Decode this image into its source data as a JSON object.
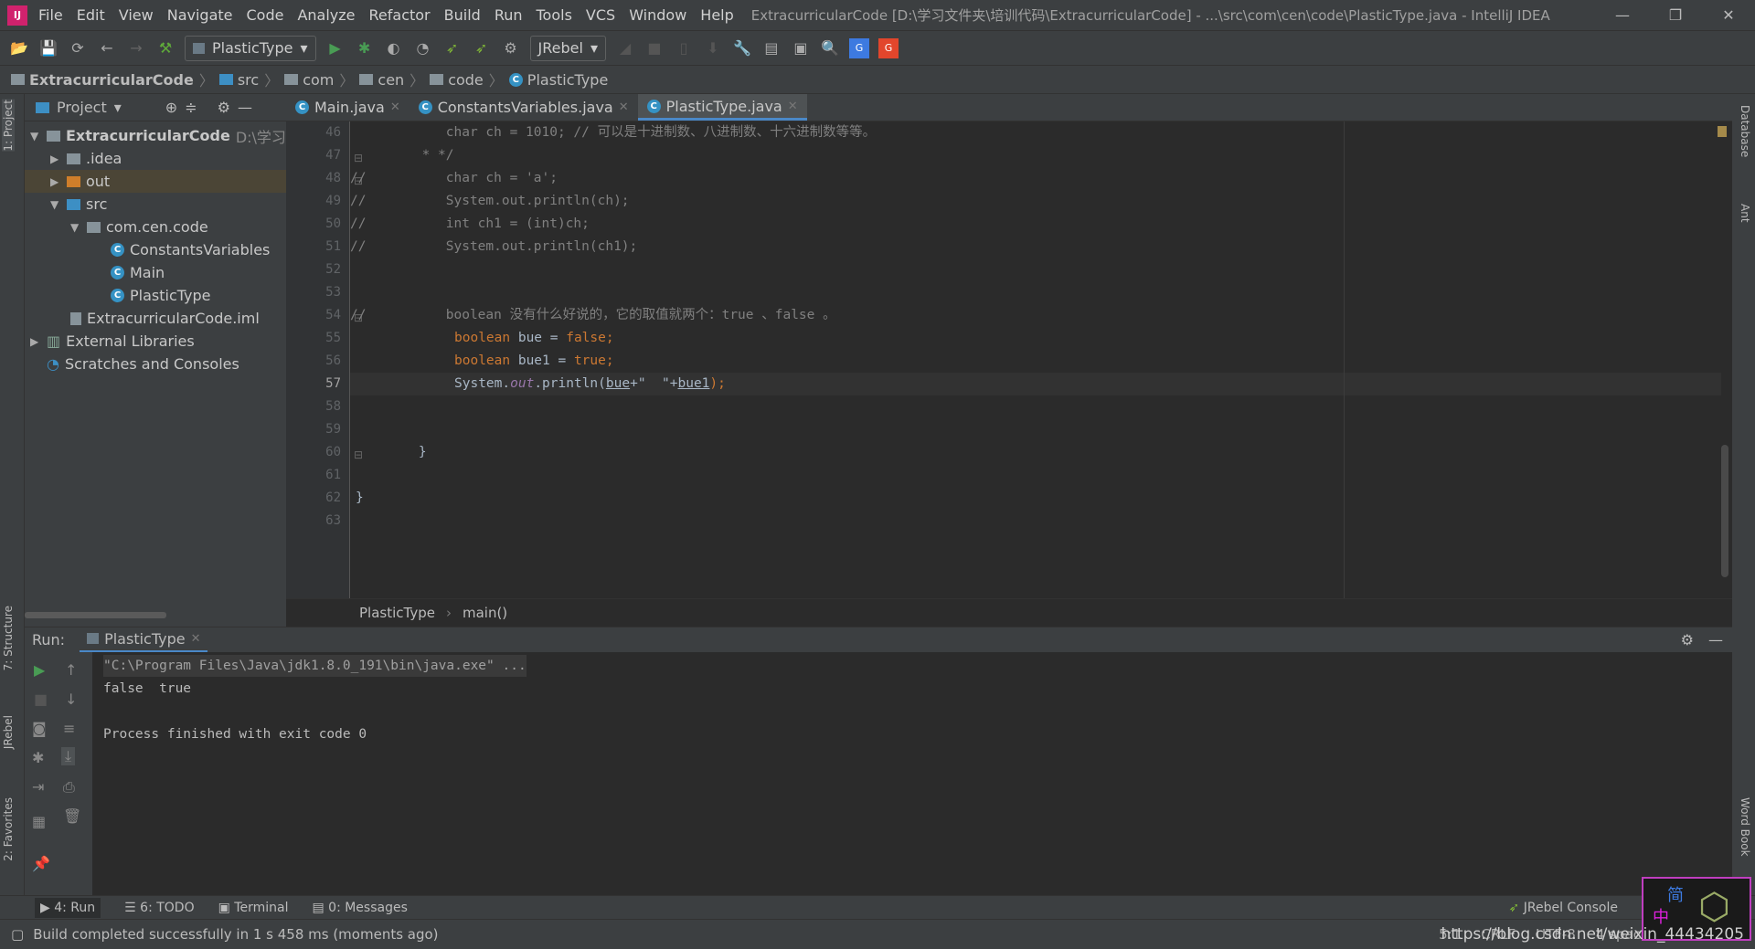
{
  "window": {
    "title": "ExtracurricularCode [D:\\学习文件夹\\培训代码\\ExtracurricularCode] - ...\\src\\com\\cen\\code\\PlasticType.java - IntelliJ IDEA",
    "controls": [
      "—",
      "❐",
      "✕"
    ]
  },
  "menu": [
    "File",
    "Edit",
    "View",
    "Navigate",
    "Code",
    "Analyze",
    "Refactor",
    "Build",
    "Run",
    "Tools",
    "VCS",
    "Window",
    "Help"
  ],
  "toolbar": {
    "run_config": "PlasticType",
    "jrebel": "JRebel"
  },
  "breadcrumb": [
    "ExtracurricularCode",
    "src",
    "com",
    "cen",
    "code",
    "PlasticType"
  ],
  "project": {
    "header": "Project",
    "tree": [
      {
        "label": "ExtracurricularCode",
        "hint": "D:\\学习文件"
      },
      {
        "label": ".idea"
      },
      {
        "label": "out"
      },
      {
        "label": "src"
      },
      {
        "label": "com.cen.code"
      },
      {
        "label": "ConstantsVariables"
      },
      {
        "label": "Main"
      },
      {
        "label": "PlasticType"
      },
      {
        "label": "ExtracurricularCode.iml"
      },
      {
        "label": "External Libraries"
      },
      {
        "label": "Scratches and Consoles"
      }
    ]
  },
  "side_tabs": {
    "left": [
      "1: Project",
      "7: Structure",
      "JRebel",
      "2: Favorites"
    ],
    "right": [
      "Database",
      "Ant",
      "Word Book"
    ]
  },
  "editor": {
    "tabs": [
      "Main.java",
      "ConstantsVariables.java",
      "PlasticType.java"
    ],
    "active_tab": 2,
    "line_numbers": [
      "46",
      "47",
      "48",
      "49",
      "50",
      "51",
      "52",
      "53",
      "54",
      "55",
      "56",
      "57",
      "58",
      "59",
      "60",
      "61",
      "62",
      "63"
    ],
    "current_line": "57",
    "crumbs": [
      "PlasticType",
      "main()"
    ]
  },
  "code": {
    "l46": "            char ch = 1010; // 可以是十进制数、八进制数、十六进制数等等。",
    "l47": "         * */",
    "l48": "//          char ch = 'a';",
    "l49": "//          System.out.println(ch);",
    "l50": "//          int ch1 = (int)ch;",
    "l51": "//          System.out.println(ch1);",
    "l54": "//          boolean 没有什么好说的，它的取值就两个：true 、false 。",
    "l55a": "boolean",
    "l55b": " bue = ",
    "l55c": "false;",
    "l56a": "boolean",
    "l56b": " bue1 = ",
    "l56c": "true;",
    "l57a": "System.",
    "l57b": "out",
    "l57c": ".println(",
    "l57d": "bue",
    "l57e": "+\"  \"+",
    "l57f": "bue1",
    "l57g": ");",
    "l60": "    }",
    "l62": "}"
  },
  "run": {
    "label": "Run:",
    "tab": "PlasticType",
    "output": [
      "\"C:\\Program Files\\Java\\jdk1.8.0_191\\bin\\java.exe\" ...",
      "false  true",
      "",
      "Process finished with exit code 0"
    ]
  },
  "bottom_tabs": [
    "4: Run",
    "6: TODO",
    "Terminal",
    "0: Messages"
  ],
  "jrebel_console": "JRebel Console",
  "status": {
    "message": "Build completed successfully in 1 s 458 ms (moments ago)",
    "position": "5:1",
    "line_sep": "CRLF",
    "encoding": "UTF-8",
    "indent": "4 spaces"
  },
  "watermark": "https://blog.csdn.net/weixin_44434205",
  "ime": {
    "a": "简",
    "b": "中"
  }
}
